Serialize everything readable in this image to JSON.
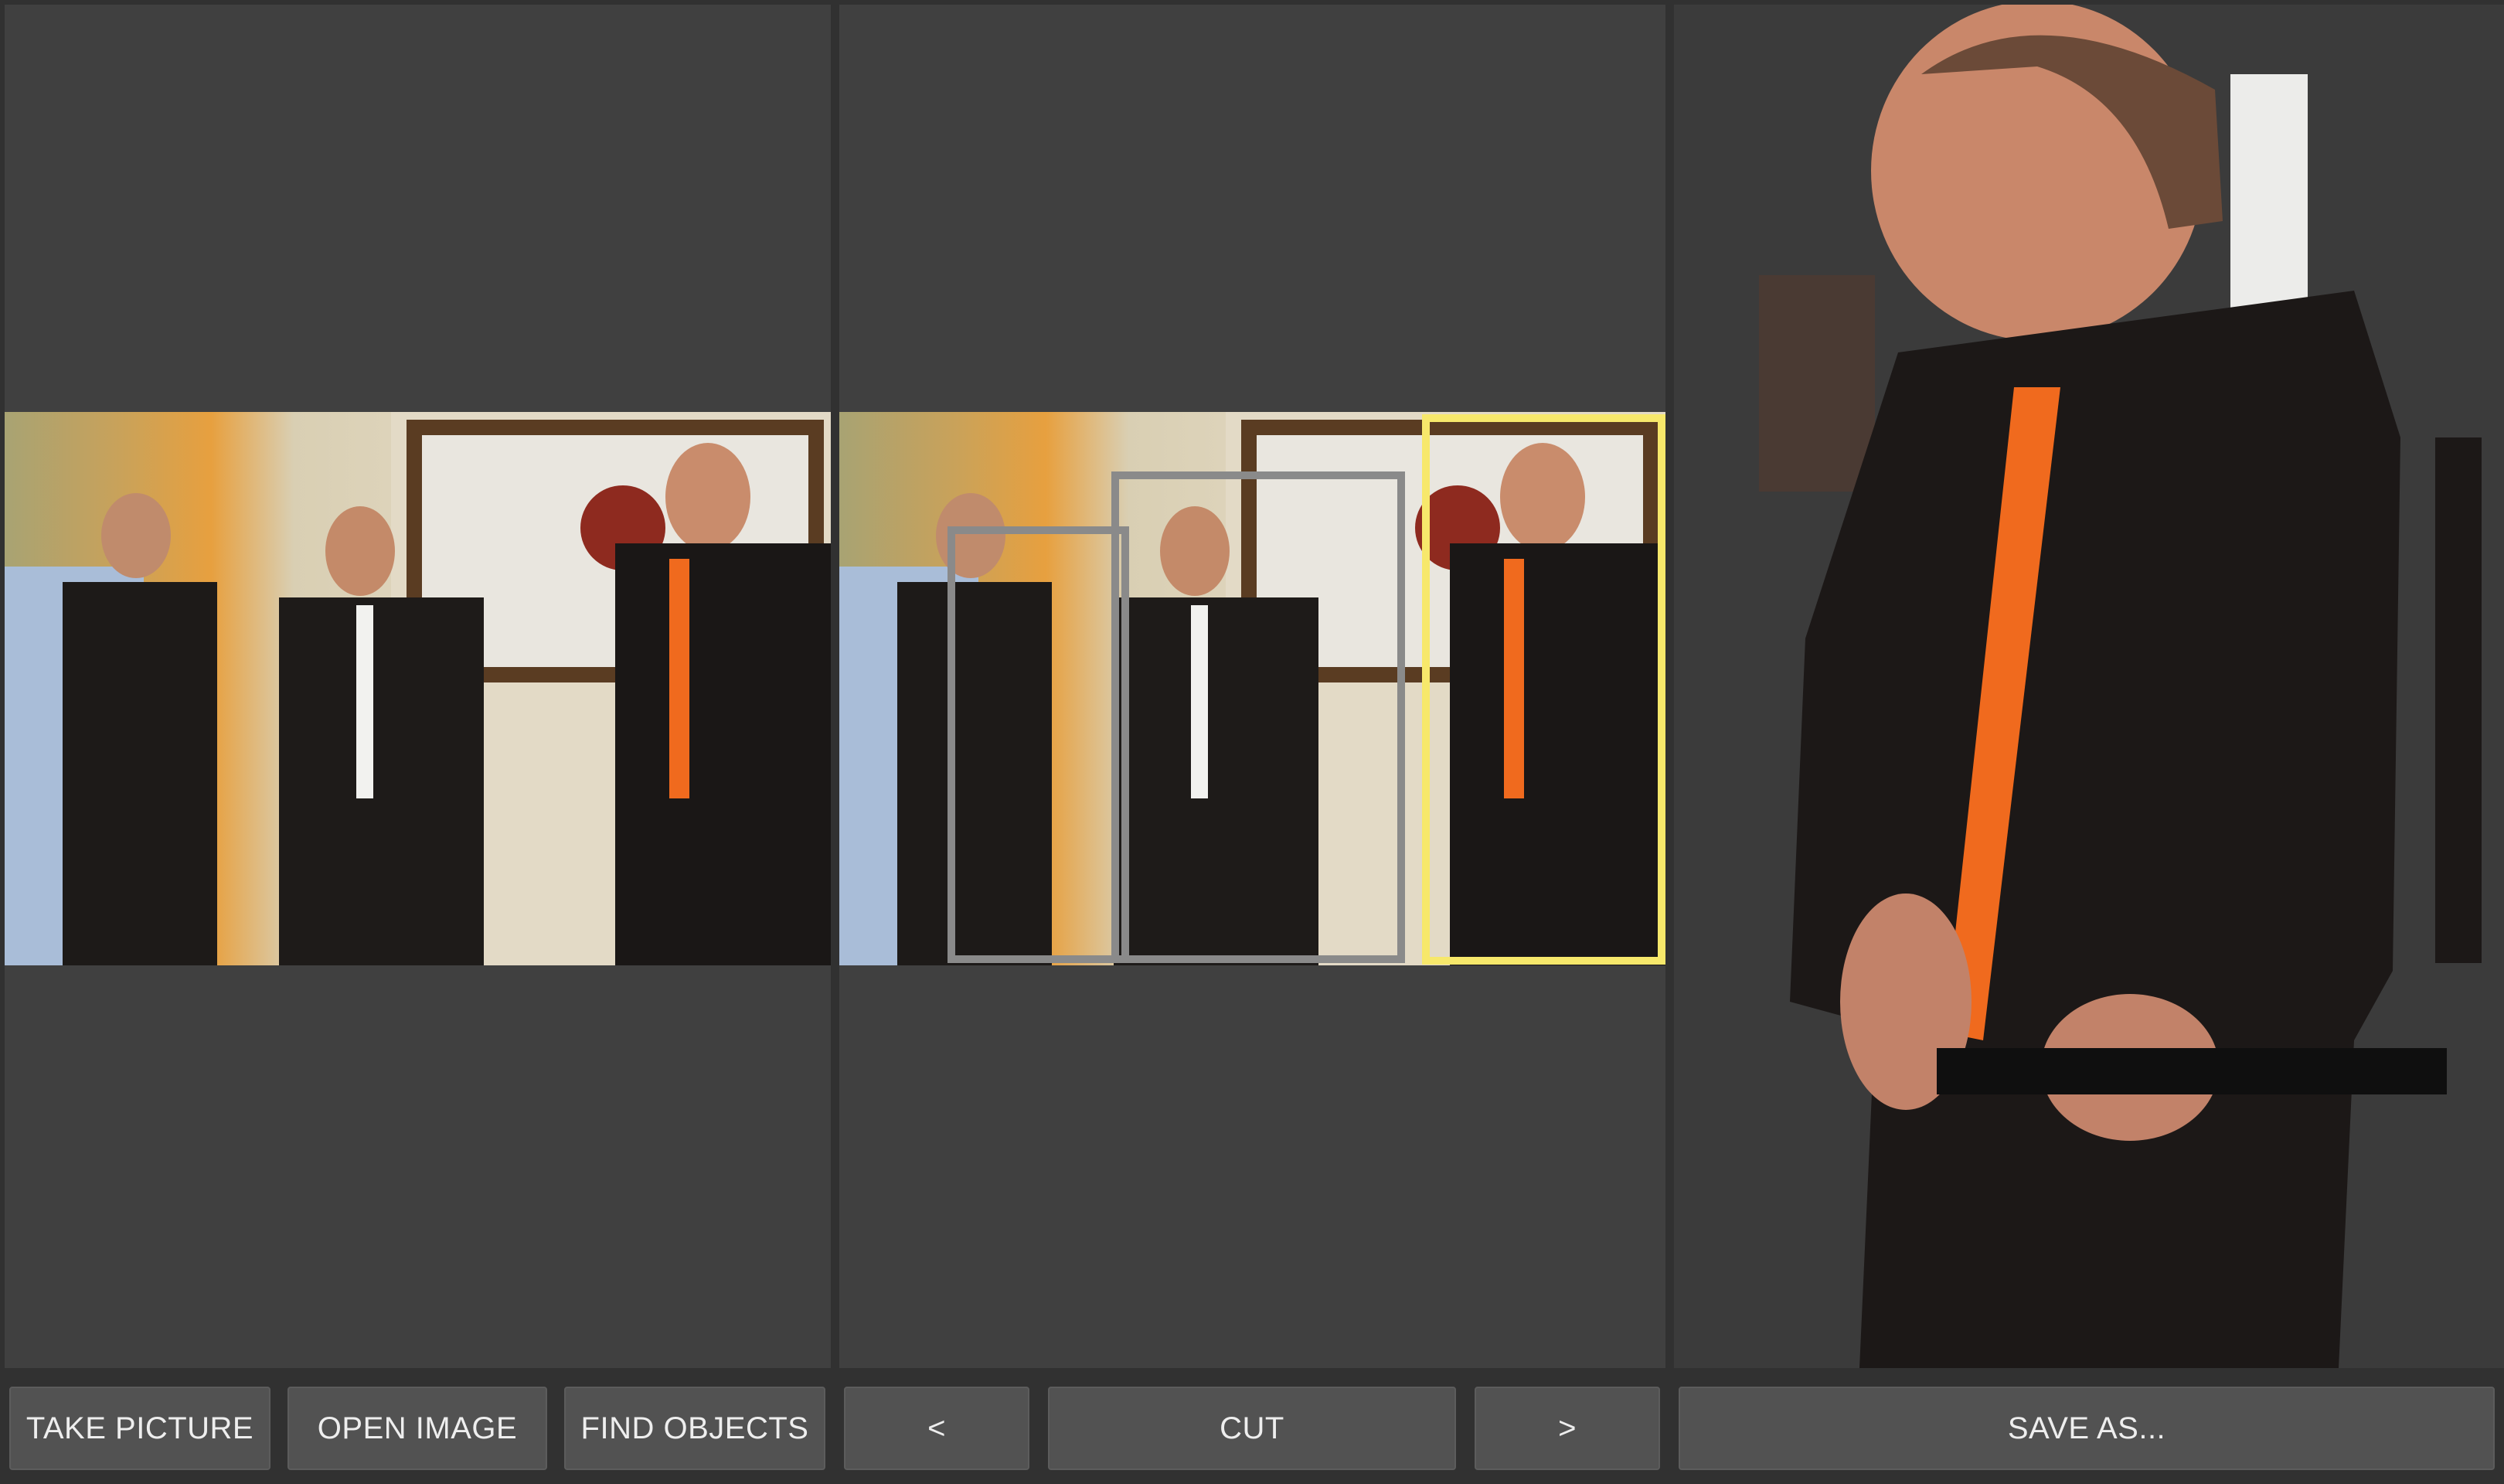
{
  "buttons": {
    "take_picture": "TAKE PICTURE",
    "open_image": "OPEN IMAGE",
    "find_objects": "FIND OBJECTS",
    "prev": "<",
    "cut": "CUT",
    "next": ">",
    "save_as": "SAVE AS..."
  },
  "colors": {
    "background": "#313131",
    "panel": "#404040",
    "button": "#525252",
    "selected_box": "#f7e86b",
    "candidate_box": "#8a8a8a"
  },
  "detection": {
    "candidate_count": 3,
    "selected_index": 3
  }
}
